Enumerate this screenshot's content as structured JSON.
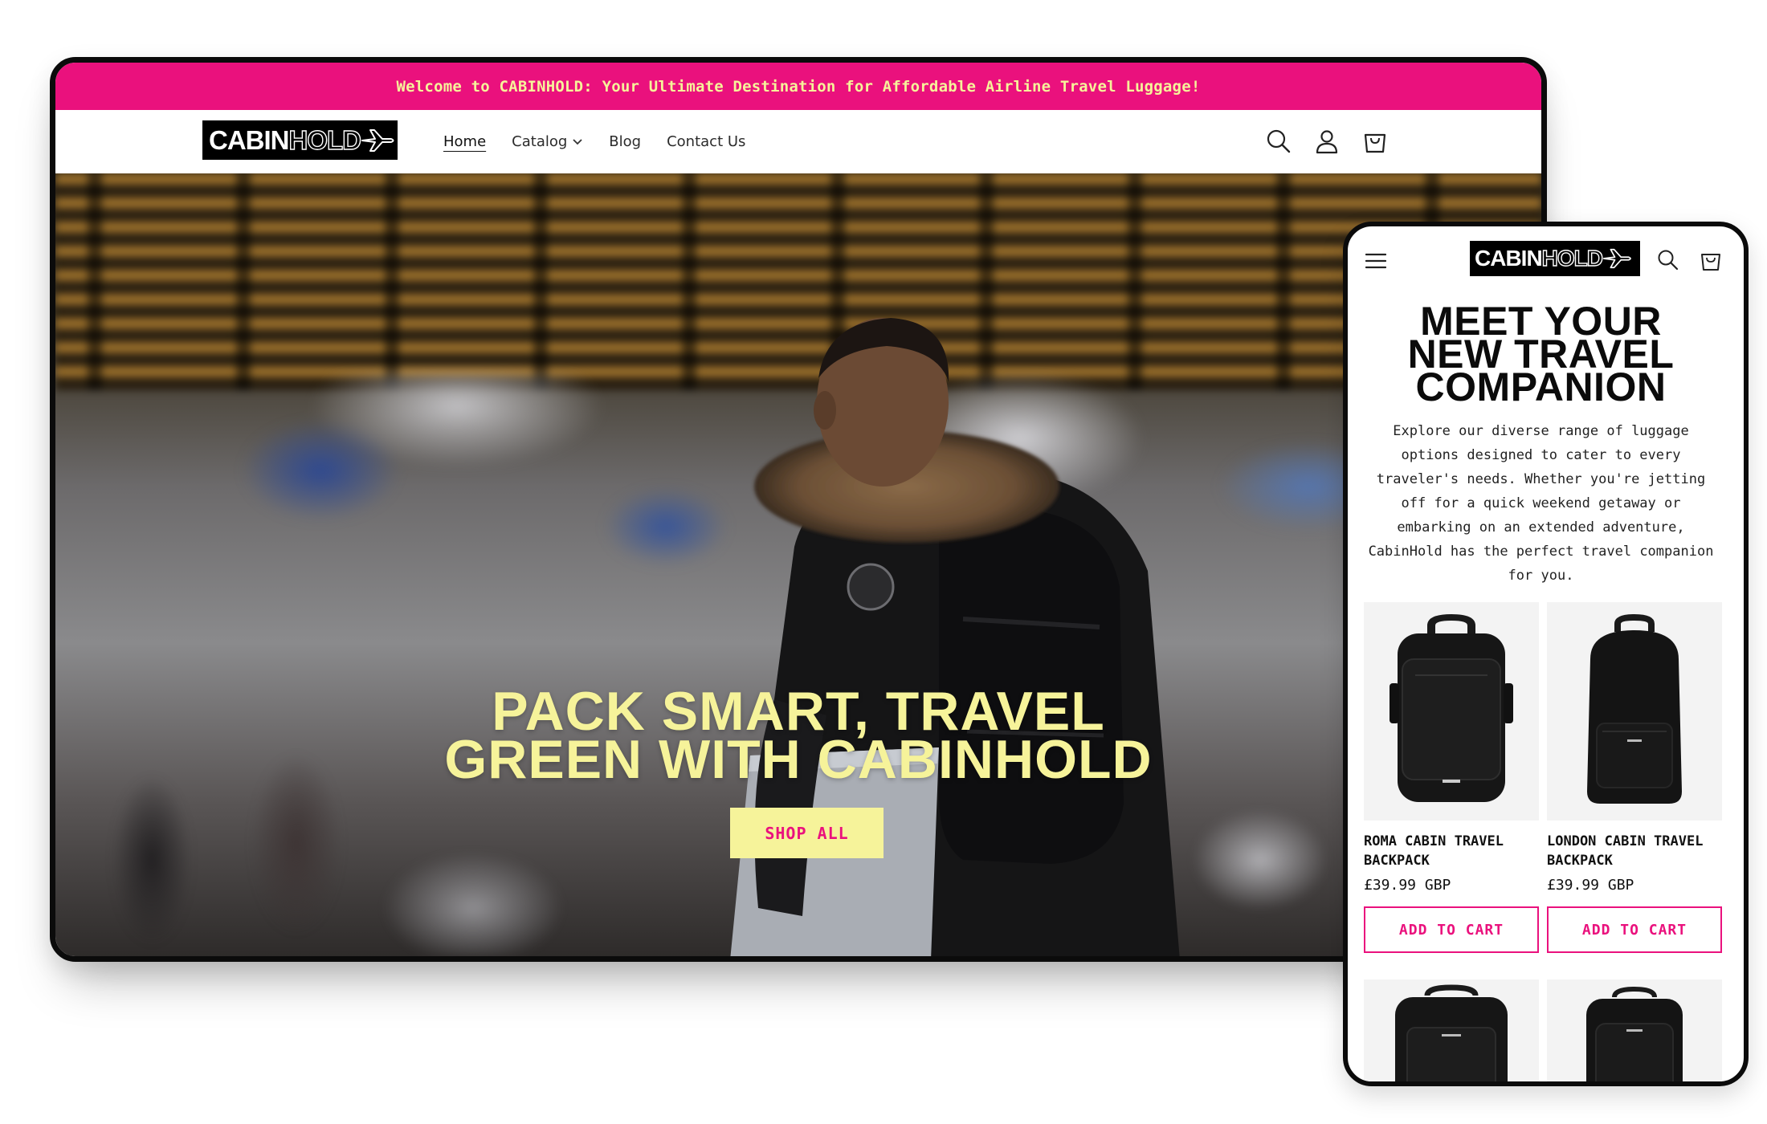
{
  "desktop": {
    "announcement": "Welcome to CABINHOLD: Your Ultimate Destination for Affordable Airline Travel Luggage!",
    "logo": {
      "part1": "CABIN",
      "part2": "HOLD"
    },
    "nav": [
      {
        "label": "Home"
      },
      {
        "label": "Catalog"
      },
      {
        "label": "Blog"
      },
      {
        "label": "Contact Us"
      }
    ],
    "icons": [
      "search-icon",
      "account-icon",
      "cart-icon"
    ],
    "hero": {
      "title_line1": "PACK SMART, TRAVEL",
      "title_line2": "GREEN WITH CABINHOLD",
      "button": "SHOP ALL"
    }
  },
  "mobile": {
    "logo": {
      "part1": "CABIN",
      "part2": "HOLD"
    },
    "icons": [
      "menu-icon",
      "search-icon",
      "cart-icon"
    ],
    "title_line1": "MEET YOUR",
    "title_line2": "NEW TRAVEL",
    "title_line3": "COMPANION",
    "description": "Explore our diverse range of luggage options designed to cater to every traveler's needs. Whether you're jetting off for a quick weekend getaway or embarking on an extended adventure, CabinHold has the perfect travel companion for you.",
    "products": [
      {
        "name": "ROMA CABIN TRAVEL BACKPACK",
        "price": "£39.99 GBP",
        "button": "ADD TO CART"
      },
      {
        "name": "LONDON CABIN TRAVEL BACKPACK",
        "price": "£39.99 GBP",
        "button": "ADD TO CART"
      }
    ]
  },
  "colors": {
    "brand_pink": "#ea117d",
    "brand_yellow": "#f6f39a",
    "black": "#0b0b0b"
  }
}
